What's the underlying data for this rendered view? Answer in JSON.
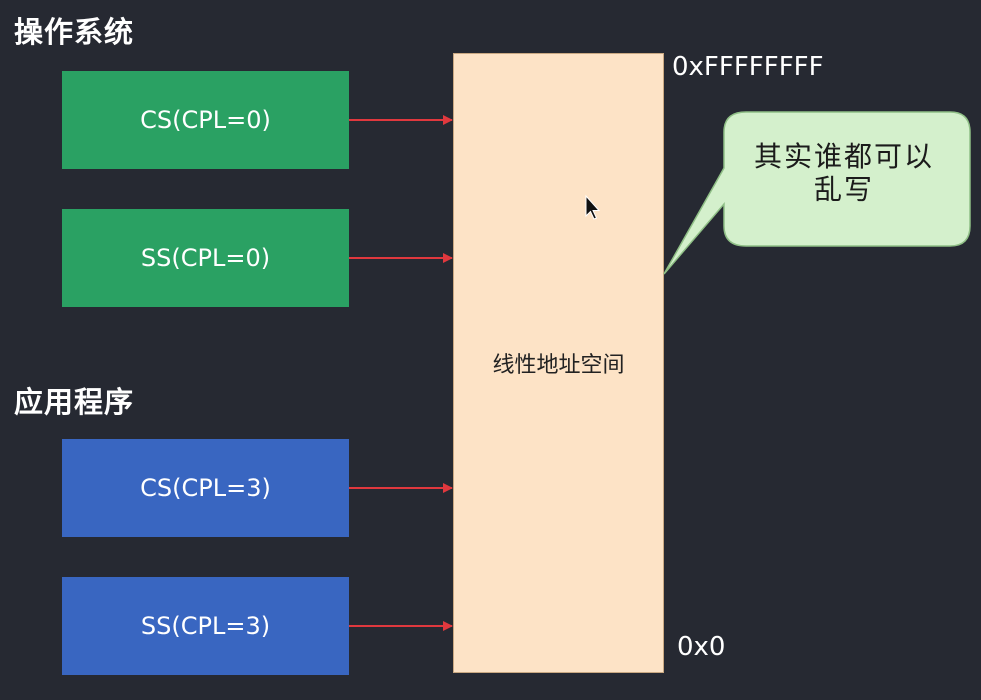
{
  "headings": {
    "os": "操作系统",
    "app": "应用程序"
  },
  "segments": {
    "os_cs": "CS(CPL=0)",
    "os_ss": "SS(CPL=0)",
    "app_cs": "CS(CPL=3)",
    "app_ss": "SS(CPL=3)"
  },
  "linear_space": {
    "label": "线性地址空间",
    "top_address": "0xFFFFFFFF",
    "bottom_address": "0x0"
  },
  "callout": {
    "line1": "其实谁都可以",
    "line2": "乱写"
  },
  "colors": {
    "background": "#262932",
    "os_segment": "#2aa163",
    "app_segment": "#3966c1",
    "linear_space": "#fde3c6",
    "callout": "#d4f0cc",
    "arrow": "#e0383e"
  }
}
